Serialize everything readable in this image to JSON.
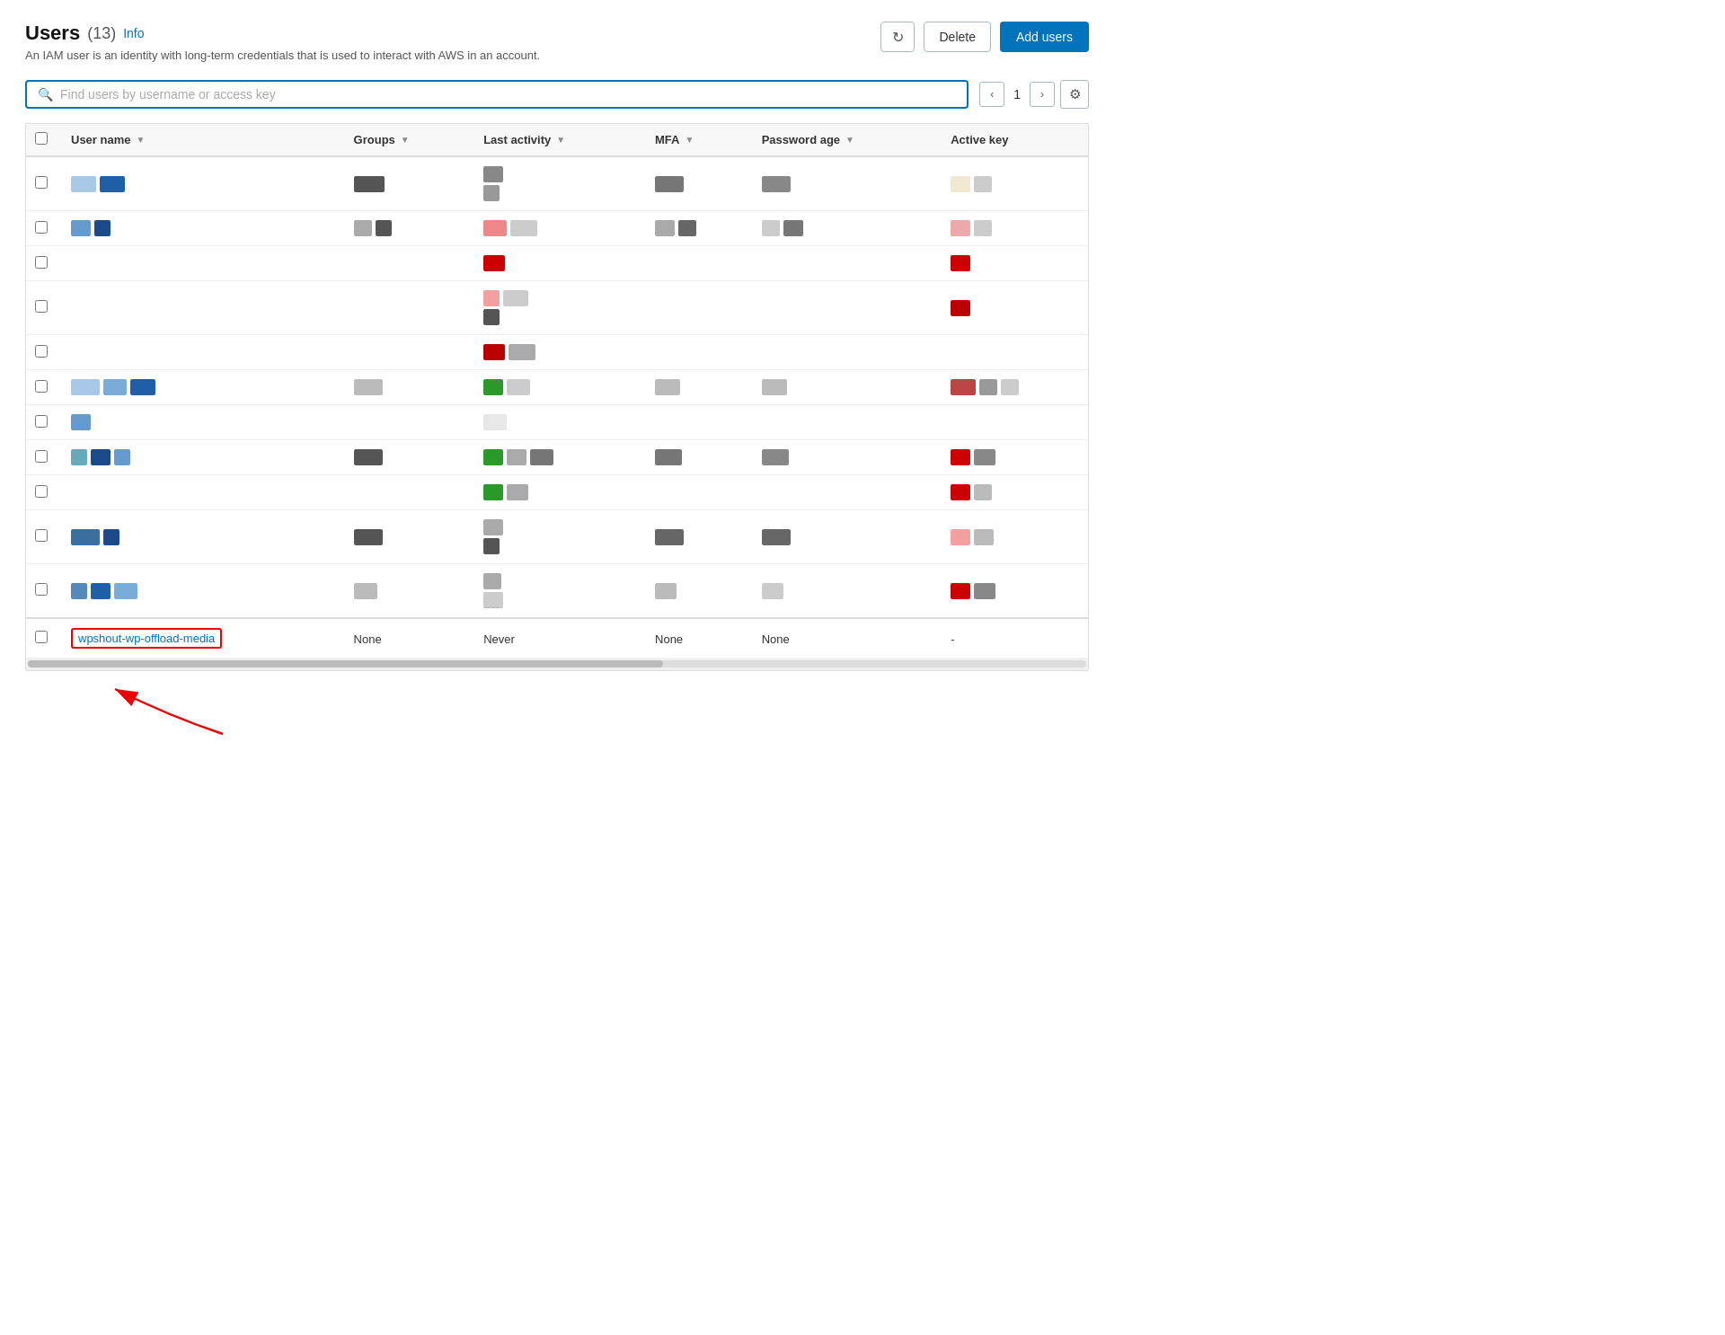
{
  "header": {
    "title": "Users",
    "count": "(13)",
    "info_label": "Info",
    "description": "An IAM user is an identity with long-term credentials that is used to interact with AWS in an account.",
    "refresh_icon": "↻",
    "delete_label": "Delete",
    "add_users_label": "Add users"
  },
  "search": {
    "placeholder": "Find users by username or access key"
  },
  "pagination": {
    "page": "1",
    "prev_icon": "‹",
    "next_icon": "›",
    "settings_icon": "⚙"
  },
  "table": {
    "columns": [
      {
        "key": "username",
        "label": "User name",
        "sortable": true
      },
      {
        "key": "groups",
        "label": "Groups",
        "sortable": true
      },
      {
        "key": "last_activity",
        "label": "Last activity",
        "sortable": true
      },
      {
        "key": "mfa",
        "label": "MFA",
        "sortable": true
      },
      {
        "key": "password_age",
        "label": "Password age",
        "sortable": true
      },
      {
        "key": "active_key",
        "label": "Active key",
        "sortable": false
      }
    ],
    "rows": [
      {
        "username_display": "blocks",
        "username_blocks": [
          {
            "w": 28,
            "color": "#a8c8e8"
          },
          {
            "w": 28,
            "color": "#1e5fa8"
          }
        ],
        "groups_blocks": [
          {
            "w": 34,
            "color": "#555"
          }
        ],
        "activity_blocks": [
          {
            "w": 22,
            "color": "#888"
          },
          {
            "w": 0,
            "color": ""
          }
        ],
        "activity_extra": [
          {
            "w": 18,
            "color": "#999"
          }
        ],
        "mfa_blocks": [
          {
            "w": 32,
            "color": "#777"
          }
        ],
        "password_blocks": [
          {
            "w": 32,
            "color": "#888"
          }
        ],
        "active_key_blocks": [
          {
            "w": 22,
            "color": "#f0e8d0"
          },
          {
            "w": 20,
            "color": "#ccc"
          }
        ],
        "highlight": false
      },
      {
        "username_display": "blocks",
        "username_blocks": [
          {
            "w": 22,
            "color": "#6699cc"
          },
          {
            "w": 18,
            "color": "#1a4a8a"
          }
        ],
        "groups_blocks": [
          {
            "w": 20,
            "color": "#aaa"
          },
          {
            "w": 18,
            "color": "#555"
          }
        ],
        "activity_blocks": [
          {
            "w": 26,
            "color": "#e88"
          },
          {
            "w": 30,
            "color": "#ccc"
          }
        ],
        "activity_extra": [],
        "mfa_blocks": [
          {
            "w": 22,
            "color": "#aaa"
          },
          {
            "w": 20,
            "color": "#666"
          }
        ],
        "password_blocks": [
          {
            "w": 20,
            "color": "#ccc"
          },
          {
            "w": 22,
            "color": "#777"
          }
        ],
        "active_key_blocks": [
          {
            "w": 22,
            "color": "#eaa"
          },
          {
            "w": 20,
            "color": "#ccc"
          }
        ],
        "highlight": false
      },
      {
        "username_display": "blocks",
        "username_blocks": [],
        "groups_blocks": [],
        "activity_blocks": [
          {
            "w": 24,
            "color": "#c00"
          }
        ],
        "activity_extra": [],
        "mfa_blocks": [],
        "password_blocks": [],
        "active_key_blocks": [
          {
            "w": 22,
            "color": "#c00"
          }
        ],
        "highlight": false
      },
      {
        "username_display": "blocks",
        "username_blocks": [],
        "groups_blocks": [],
        "activity_blocks": [
          {
            "w": 18,
            "color": "#f4a0a0"
          },
          {
            "w": 28,
            "color": "#ccc"
          }
        ],
        "activity_extra": [
          {
            "w": 18,
            "color": "#555"
          }
        ],
        "mfa_blocks": [],
        "password_blocks": [],
        "active_key_blocks": [
          {
            "w": 22,
            "color": "#b00"
          }
        ],
        "highlight": false
      },
      {
        "username_display": "blocks",
        "username_blocks": [],
        "groups_blocks": [],
        "activity_blocks": [
          {
            "w": 24,
            "color": "#b00"
          },
          {
            "w": 30,
            "color": "#aaa"
          }
        ],
        "activity_extra": [],
        "mfa_blocks": [],
        "password_blocks": [],
        "active_key_blocks": [],
        "highlight": false
      },
      {
        "username_display": "blocks",
        "username_blocks": [
          {
            "w": 32,
            "color": "#a8c8e8"
          },
          {
            "w": 26,
            "color": "#7aacda"
          },
          {
            "w": 28,
            "color": "#1e5fa8"
          }
        ],
        "groups_blocks": [
          {
            "w": 32,
            "color": "#bbb"
          }
        ],
        "activity_blocks": [
          {
            "w": 22,
            "color": "#2a9a2a"
          },
          {
            "w": 26,
            "color": "#ccc"
          }
        ],
        "activity_extra": [],
        "mfa_blocks": [
          {
            "w": 28,
            "color": "#bbb"
          }
        ],
        "password_blocks": [
          {
            "w": 28,
            "color": "#bbb"
          }
        ],
        "active_key_blocks": [
          {
            "w": 28,
            "color": "#b44"
          },
          {
            "w": 20,
            "color": "#999"
          },
          {
            "w": 20,
            "color": "#ccc"
          }
        ],
        "highlight": false
      },
      {
        "username_display": "blocks",
        "username_blocks": [
          {
            "w": 22,
            "color": "#6699cc"
          }
        ],
        "groups_blocks": [],
        "activity_blocks": [],
        "activity_extra": [
          {
            "w": 26,
            "color": "#e8e8e8"
          }
        ],
        "mfa_blocks": [],
        "password_blocks": [],
        "active_key_blocks": [],
        "highlight": false
      },
      {
        "username_display": "blocks",
        "username_blocks": [
          {
            "w": 18,
            "color": "#6ab"
          },
          {
            "w": 22,
            "color": "#1a4a8a"
          },
          {
            "w": 18,
            "color": "#6699cc"
          }
        ],
        "groups_blocks": [
          {
            "w": 32,
            "color": "#555"
          }
        ],
        "activity_blocks": [
          {
            "w": 22,
            "color": "#2a9a2a"
          },
          {
            "w": 22,
            "color": "#aaa"
          },
          {
            "w": 26,
            "color": "#777"
          }
        ],
        "activity_extra": [],
        "mfa_blocks": [
          {
            "w": 30,
            "color": "#777"
          }
        ],
        "password_blocks": [
          {
            "w": 30,
            "color": "#888"
          }
        ],
        "active_key_blocks": [
          {
            "w": 22,
            "color": "#c00"
          },
          {
            "w": 24,
            "color": "#888"
          }
        ],
        "highlight": false
      },
      {
        "username_display": "blocks",
        "username_blocks": [],
        "groups_blocks": [],
        "activity_blocks": [
          {
            "w": 22,
            "color": "#2a9a2a"
          },
          {
            "w": 24,
            "color": "#aaa"
          }
        ],
        "activity_extra": [],
        "mfa_blocks": [],
        "password_blocks": [],
        "active_key_blocks": [
          {
            "w": 22,
            "color": "#c00"
          },
          {
            "w": 20,
            "color": "#bbb"
          }
        ],
        "highlight": false
      },
      {
        "username_display": "blocks",
        "username_blocks": [
          {
            "w": 32,
            "color": "#3a6fa0"
          },
          {
            "w": 18,
            "color": "#1a4a8a"
          }
        ],
        "groups_blocks": [
          {
            "w": 32,
            "color": "#555"
          }
        ],
        "activity_blocks": [
          {
            "w": 22,
            "color": "#aaa"
          }
        ],
        "activity_extra": [
          {
            "w": 18,
            "color": "#555"
          }
        ],
        "mfa_blocks": [
          {
            "w": 32,
            "color": "#666"
          }
        ],
        "password_blocks": [
          {
            "w": 32,
            "color": "#666"
          }
        ],
        "active_key_blocks": [
          {
            "w": 22,
            "color": "#f4a0a0"
          },
          {
            "w": 22,
            "color": "#bbb"
          }
        ],
        "highlight": false
      },
      {
        "username_display": "blocks",
        "username_blocks": [
          {
            "w": 18,
            "color": "#5588bb"
          },
          {
            "w": 22,
            "color": "#1e5fa8"
          },
          {
            "w": 26,
            "color": "#7aacda"
          }
        ],
        "groups_blocks": [
          {
            "w": 26,
            "color": "#bbb"
          }
        ],
        "activity_blocks": [
          {
            "w": 20,
            "color": "#aaa"
          }
        ],
        "activity_extra": [
          {
            "w": 22,
            "color": "#ccc"
          }
        ],
        "mfa_blocks": [
          {
            "w": 24,
            "color": "#bbb"
          }
        ],
        "password_blocks": [
          {
            "w": 24,
            "color": "#ccc"
          }
        ],
        "active_key_blocks": [
          {
            "w": 22,
            "color": "#c00"
          },
          {
            "w": 24,
            "color": "#888"
          }
        ],
        "highlight": false
      },
      {
        "username_display": "wpshout-wp-offload-media",
        "username_link": "wpshout-wp-offload-media",
        "groups_text": "None",
        "activity_text": "Never",
        "mfa_text": "None",
        "password_text": "None",
        "active_key_text": "-",
        "highlight": true
      }
    ]
  },
  "arrow": {
    "label": "wpshout-wp-offload-media"
  }
}
